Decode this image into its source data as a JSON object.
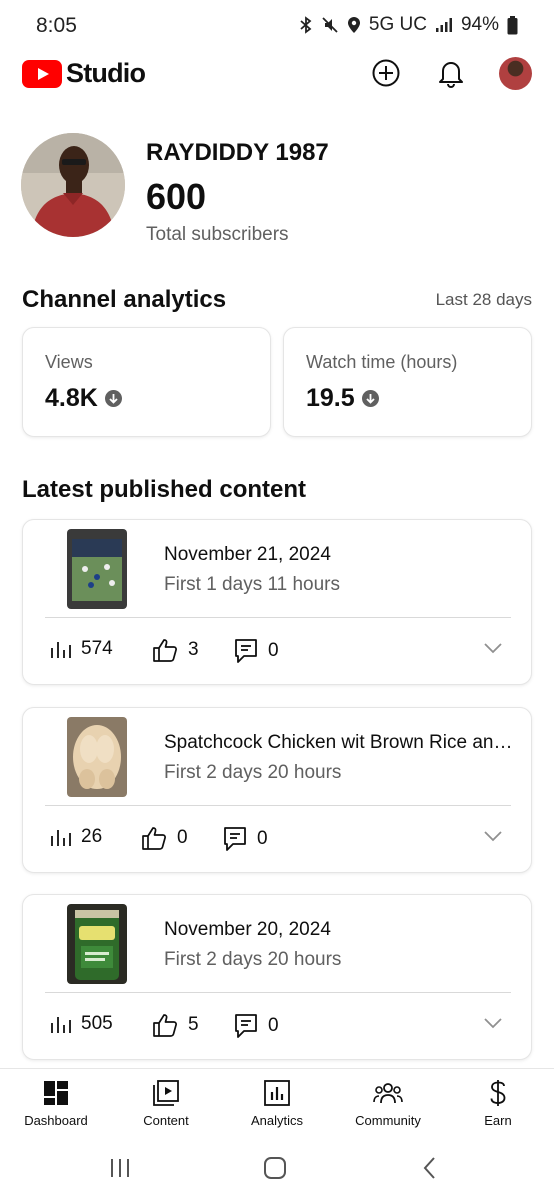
{
  "status_bar": {
    "time": "8:05",
    "network": "5G UC",
    "battery": "94%"
  },
  "app": {
    "logo_text": "Studio",
    "brand_color": "#FF0000"
  },
  "channel": {
    "name": "RAYDIDDY 1987",
    "subscribers": "600",
    "subscribers_label": "Total subscribers"
  },
  "analytics": {
    "title": "Channel analytics",
    "range": "Last 28 days",
    "cards": [
      {
        "label": "Views",
        "value": "4.8K",
        "trend": "down"
      },
      {
        "label": "Watch time (hours)",
        "value": "19.5",
        "trend": "down"
      }
    ]
  },
  "latest": {
    "title": "Latest published content",
    "items": [
      {
        "title": "November 21, 2024",
        "subtitle": "First 1 days 11 hours",
        "views": "574",
        "likes": "3",
        "comments": "0",
        "thumb": "football-screen"
      },
      {
        "title": "Spatchcock Chicken wit Brown Rice and Broccoli",
        "subtitle": "First 2 days 20 hours",
        "views": "26",
        "likes": "0",
        "comments": "0",
        "thumb": "raw-chicken"
      },
      {
        "title": "November 20, 2024",
        "subtitle": "First 2 days 20 hours",
        "views": "505",
        "likes": "5",
        "comments": "0",
        "thumb": "pine-sol-bottle"
      }
    ]
  },
  "nav": [
    {
      "label": "Dashboard",
      "icon": "dashboard-icon",
      "active": true
    },
    {
      "label": "Content",
      "icon": "content-icon"
    },
    {
      "label": "Analytics",
      "icon": "analytics-icon"
    },
    {
      "label": "Community",
      "icon": "community-icon"
    },
    {
      "label": "Earn",
      "icon": "earn-icon"
    }
  ]
}
